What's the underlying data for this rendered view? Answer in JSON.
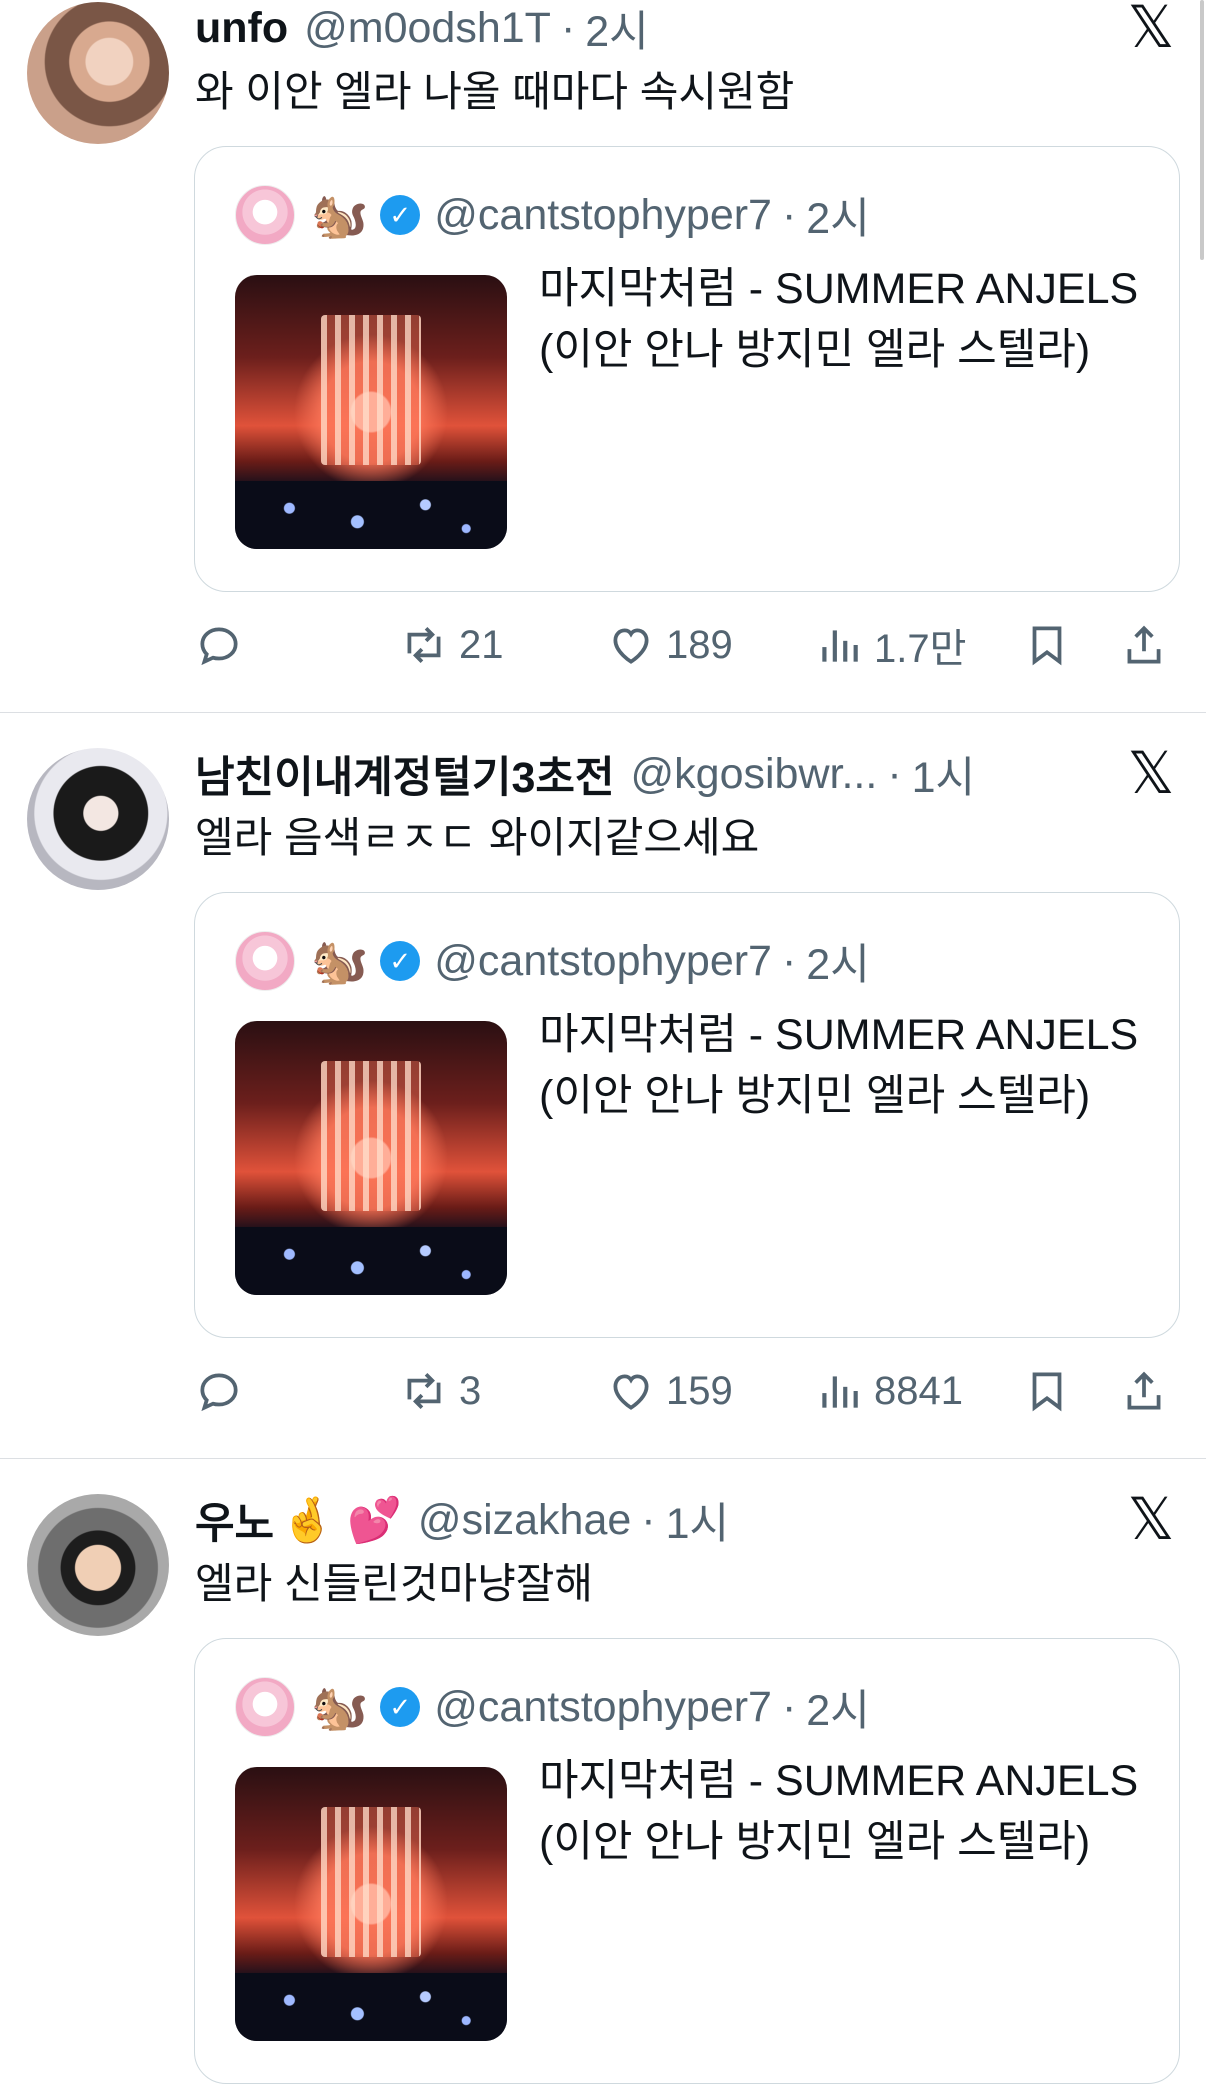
{
  "tweets": [
    {
      "name": "unfo",
      "handle": "@m0odsh1T",
      "time": "2시",
      "emoji": "",
      "text": "와 이안 엘라 나올 때마다 속시원함",
      "quote": {
        "handle": "@cantstophyper7",
        "time": "2시",
        "emoji": "🐿️",
        "title": "마지막처럼 - SUMMER ANJELS (이안 안나 방지민 엘라 스텔라)"
      },
      "actions": {
        "retweets": "21",
        "likes": "189",
        "views": "1.7만"
      }
    },
    {
      "name": "남친이내계정털기3초전",
      "handle": "@kgosibwr...",
      "time": "1시",
      "emoji": "",
      "text": "엘라 음색ㄹㅈㄷ 와이지같으세요",
      "quote": {
        "handle": "@cantstophyper7",
        "time": "2시",
        "emoji": "🐿️",
        "title": "마지막처럼 - SUMMER ANJELS (이안 안나 방지민 엘라 스텔라)"
      },
      "actions": {
        "retweets": "3",
        "likes": "159",
        "views": "8841"
      }
    },
    {
      "name": "우노",
      "handle": "@sizakhae",
      "time": "1시",
      "emoji": "🤞 💕",
      "text": "엘라 신들린것마냥잘해",
      "quote": {
        "handle": "@cantstophyper7",
        "time": "2시",
        "emoji": "🐿️",
        "title": "마지막처럼 - SUMMER ANJELS (이안 안나 방지민 엘라 스텔라)"
      }
    }
  ],
  "separator": "·",
  "x_logo": "𝕏",
  "icons": {
    "reply": "reply-icon",
    "retweet": "retweet-icon",
    "like": "heart-icon",
    "views": "views-icon",
    "bookmark": "bookmark-icon",
    "share": "share-icon",
    "verified": "verified-badge-icon"
  },
  "colors": {
    "text": "#0f1419",
    "muted": "#536471",
    "verified": "#1d9bf0",
    "border": "#cfd9de"
  }
}
